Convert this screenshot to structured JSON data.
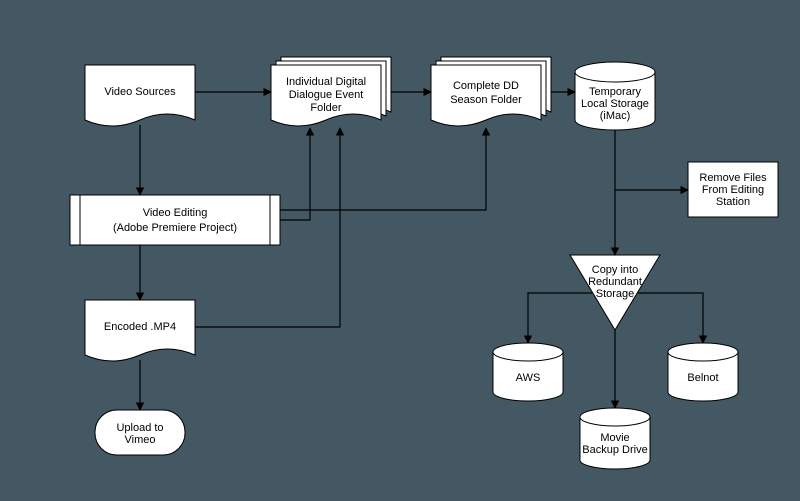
{
  "diagram": {
    "nodes": {
      "video_sources": "Video Sources",
      "individual_folder_l1": "Individual Digital",
      "individual_folder_l2": "Dialogue Event",
      "individual_folder_l3": "Folder",
      "complete_folder_l1": "Complete DD",
      "complete_folder_l2": "Season Folder",
      "temp_storage_l1": "Temporary",
      "temp_storage_l2": "Local Storage",
      "temp_storage_l3": "(iMac)",
      "remove_files_l1": "Remove Files",
      "remove_files_l2": "From Editing",
      "remove_files_l3": "Station",
      "video_editing_l1": "Video Editing",
      "video_editing_l2": "(Adobe Premiere Project)",
      "encoded_mp4": "Encoded .MP4",
      "upload_vimeo_l1": "Upload to",
      "upload_vimeo_l2": "Vimeo",
      "copy_redundant_l1": "Copy into",
      "copy_redundant_l2": "Redundant",
      "copy_redundant_l3": "Storage",
      "aws": "AWS",
      "belnot": "Belnot",
      "movie_backup_l1": "Movie",
      "movie_backup_l2": "Backup Drive"
    }
  }
}
